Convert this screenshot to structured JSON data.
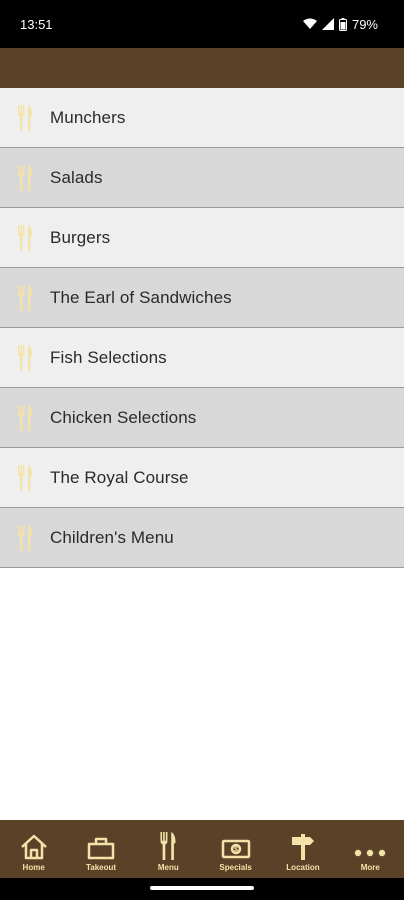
{
  "status": {
    "time": "13:51",
    "battery": "79%"
  },
  "menu_items": [
    {
      "label": "Munchers"
    },
    {
      "label": "Salads"
    },
    {
      "label": "Burgers"
    },
    {
      "label": "The Earl of Sandwiches"
    },
    {
      "label": "Fish Selections"
    },
    {
      "label": "Chicken Selections"
    },
    {
      "label": "The Royal Course"
    },
    {
      "label": "Children's Menu"
    }
  ],
  "tabs": [
    {
      "label": "Home",
      "icon": "home-icon"
    },
    {
      "label": "Takeout",
      "icon": "bag-icon"
    },
    {
      "label": "Menu",
      "icon": "fork-knife-icon"
    },
    {
      "label": "Specials",
      "icon": "dollar-bill-icon"
    },
    {
      "label": "Location",
      "icon": "signpost-icon"
    },
    {
      "label": "More",
      "icon": "more-dots-icon"
    }
  ],
  "colors": {
    "brown": "#5a4128",
    "cream": "#f3e3a8",
    "row_light": "#efefef",
    "row_dark": "#d8d8d8"
  }
}
